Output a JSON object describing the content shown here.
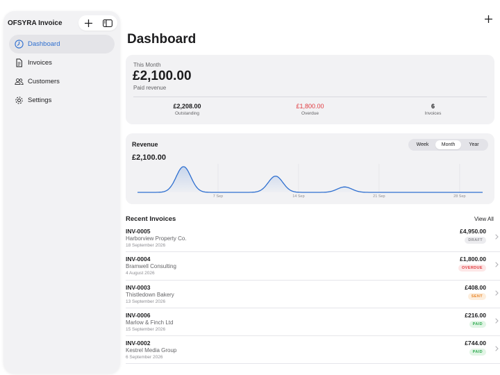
{
  "app": {
    "title": "OFSYRA Invoice"
  },
  "sidebar": {
    "items": [
      {
        "label": "Dashboard",
        "icon": "clock-icon",
        "active": true
      },
      {
        "label": "Invoices",
        "icon": "document-icon",
        "active": false
      },
      {
        "label": "Customers",
        "icon": "people-icon",
        "active": false
      },
      {
        "label": "Settings",
        "icon": "gear-icon",
        "active": false
      }
    ]
  },
  "page": {
    "title": "Dashboard"
  },
  "summary": {
    "label": "This Month",
    "amount": "£2,100.00",
    "sub": "Paid revenue",
    "stats": [
      {
        "value": "£2,208.00",
        "label": "Outstanding",
        "color": "#1c1c1e"
      },
      {
        "value": "£1,800.00",
        "label": "Overdue",
        "color": "#e0393e"
      },
      {
        "value": "6",
        "label": "Invoices",
        "color": "#1c1c1e"
      }
    ]
  },
  "revenue": {
    "title": "Revenue",
    "amount": "£2,100.00",
    "periods": [
      "Week",
      "Month",
      "Year"
    ],
    "selected_period": "Month",
    "x_ticks": [
      "7 Sep",
      "14 Sep",
      "21 Sep",
      "28 Sep"
    ]
  },
  "chart_data": {
    "type": "area",
    "x_ticks": [
      "7 Sep",
      "14 Sep",
      "21 Sep",
      "28 Sep"
    ],
    "peaks": [
      {
        "day": 4,
        "value": 0.95
      },
      {
        "day": 12,
        "value": 0.6
      },
      {
        "day": 18,
        "value": 0.2
      }
    ],
    "line_color": "#2e6fd0",
    "grid": false
  },
  "recent": {
    "title": "Recent Invoices",
    "view_all": "View All",
    "invoices": [
      {
        "id": "INV-0005",
        "client": "Harborview Property Co.",
        "date": "18 September 2026",
        "amount": "£4,950.00",
        "status": "DRAFT",
        "status_fg": "#8e8e93",
        "status_bg": "#ececef"
      },
      {
        "id": "INV-0004",
        "client": "Bramwell Consulting",
        "date": "4 August 2026",
        "amount": "£1,800.00",
        "status": "OVERDUE",
        "status_fg": "#e0393e",
        "status_bg": "#fde7e7"
      },
      {
        "id": "INV-0003",
        "client": "Thistledown Bakery",
        "date": "13 September 2026",
        "amount": "£408.00",
        "status": "SENT",
        "status_fg": "#e8862a",
        "status_bg": "#fdeedd"
      },
      {
        "id": "INV-0006",
        "client": "Marlow & Finch Ltd",
        "date": "15 September 2026",
        "amount": "£216.00",
        "status": "PAID",
        "status_fg": "#2eaa4f",
        "status_bg": "#e2f5e6"
      },
      {
        "id": "INV-0002",
        "client": "Kestrel Media Group",
        "date": "6 September 2026",
        "amount": "£744.00",
        "status": "PAID",
        "status_fg": "#2eaa4f",
        "status_bg": "#e2f5e6"
      }
    ]
  }
}
